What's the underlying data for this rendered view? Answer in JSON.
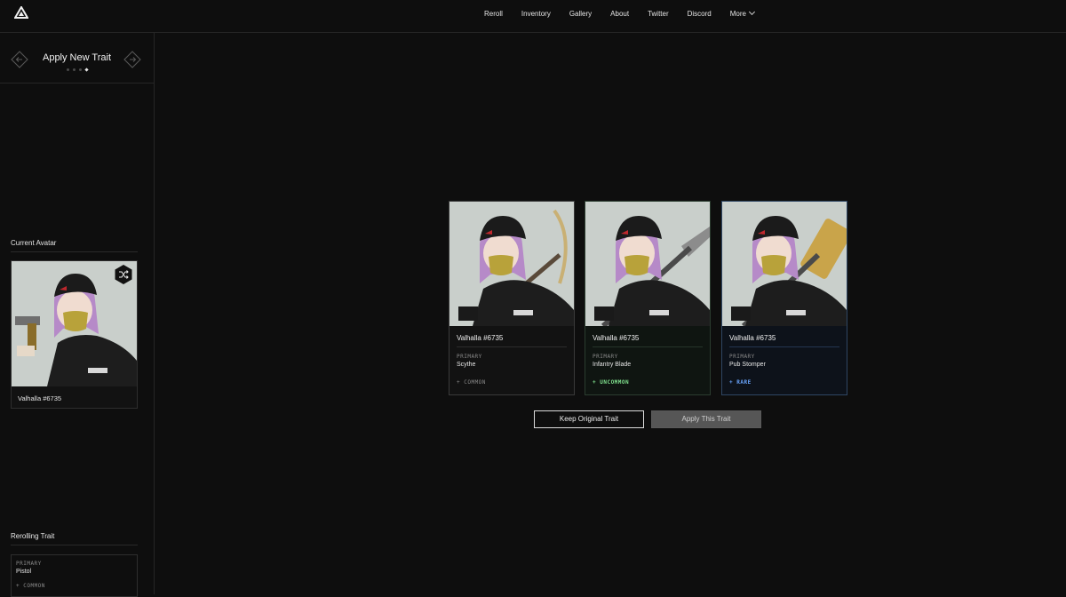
{
  "nav": {
    "items": [
      "Reroll",
      "Inventory",
      "Gallery",
      "About",
      "Twitter",
      "Discord"
    ],
    "more_label": "More"
  },
  "sidebar": {
    "title": "Apply New Trait",
    "steps_total": 4,
    "step_active": 4,
    "current_avatar_label": "Current Avatar",
    "avatar_name": "Valhalla #6735",
    "rerolling_trait_label": "Rerolling Trait",
    "rerolling_trait": {
      "type": "PRIMARY",
      "name": "Pistol",
      "rarity": "COMMON"
    }
  },
  "options": [
    {
      "name": "Valhalla #6735",
      "type": "PRIMARY",
      "trait": "Scythe",
      "rarity": "COMMON",
      "rarity_color": "#8a8a8a"
    },
    {
      "name": "Valhalla #6735",
      "type": "PRIMARY",
      "trait": "Infantry Blade",
      "rarity": "UNCOMMON",
      "rarity_color": "#7fe08d"
    },
    {
      "name": "Valhalla #6735",
      "type": "PRIMARY",
      "trait": "Pub Stomper",
      "rarity": "RARE",
      "rarity_color": "#6aa6ff"
    }
  ],
  "actions": {
    "keep_label": "Keep Original Trait",
    "apply_label": "Apply This Trait"
  },
  "colors": {
    "background": "#0e0e0e",
    "portrait_bg": "#c9cfcb",
    "uncommon": "#7fe08d",
    "rare": "#6aa6ff"
  }
}
